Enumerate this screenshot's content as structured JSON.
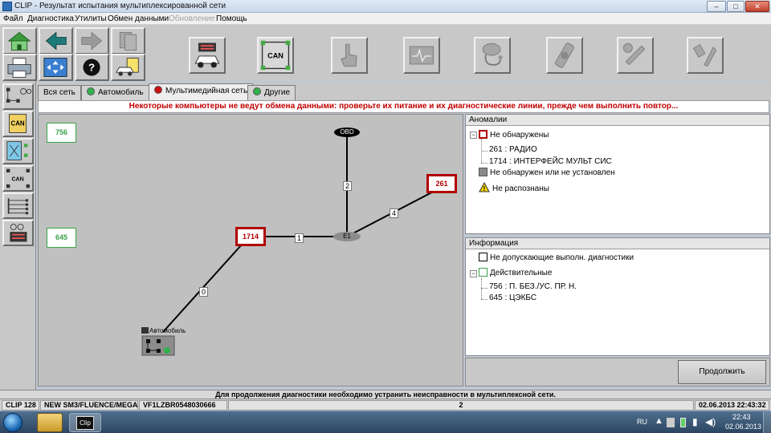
{
  "window": {
    "title": "CLIP - Результат испытания мультиплексированной сети",
    "controls": [
      "–",
      "□",
      "✕"
    ]
  },
  "menu": {
    "items": [
      "Файл",
      "Диагностика",
      "Утилиты",
      "Обмен данными",
      "Обновление",
      "Помощь"
    ]
  },
  "toolbar": {
    "can_label": "CAN"
  },
  "sidebar": {
    "can_label": "CAN",
    "can_label2": "CAN"
  },
  "tabs": [
    {
      "label": "Вся сеть",
      "status": "none"
    },
    {
      "label": "Автомобиль",
      "status": "green"
    },
    {
      "label": "Мультимедийная сеть",
      "status": "red"
    },
    {
      "label": "Другие",
      "status": "green"
    }
  ],
  "colors": {
    "error_red": "#b00000",
    "ok_green": "#3aa14a",
    "warning_yellow": "#f2d200"
  },
  "banner": "Некоторые компьютеры не ведут обмена данными: проверьте их питание и их диагностические линии, прежде чем выполнить повтор...",
  "network": {
    "nodes": {
      "n756": "756",
      "n645": "645",
      "n1714": "1714",
      "n261": "261",
      "obd": "OBD",
      "e1": "E1",
      "car": "Автомобиль"
    },
    "edges": [
      "0",
      "1",
      "2",
      "4"
    ]
  },
  "anomalies": {
    "header": "Аномалии",
    "not_detected": "Не обнаружены",
    "items": [
      "261 : РАДИО",
      "1714 : ИНТЕРФЕЙС МУЛЬТ СИС"
    ],
    "not_detected_or_installed": "Не обнаружен или не установлен",
    "not_recognized": "Не распознаны"
  },
  "info": {
    "header": "Информация",
    "not_allowing": "Не допускающие выполн. диагностики",
    "valid": "Действительные",
    "items": [
      "756 : П. БЕЗ./УС. ПР. Н.",
      "645 : ЦЭКБС"
    ]
  },
  "continue_button": "Продолжить",
  "status_message": "Для продолжения диагностики необходимо устранить неисправности в мультиплексной сети.",
  "infobar": {
    "clip": "CLIP 128",
    "vehicle": "NEW SM3/FLUENCE/MEGA",
    "vin": "VF1LZBR0548030666",
    "page": "2",
    "datetime": "02.06.2013 22:43:32"
  },
  "taskbar": {
    "lang": "RU",
    "time": "22:43",
    "date": "02.06.2013",
    "clip_icon_label": "Clip"
  }
}
